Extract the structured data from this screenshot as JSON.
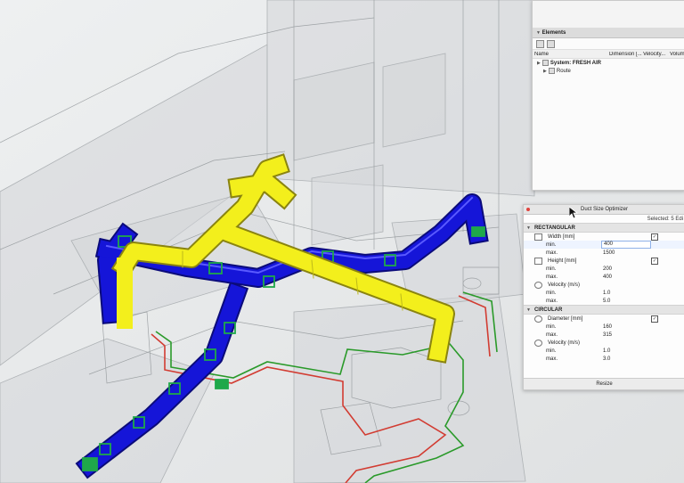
{
  "elements_panel": {
    "header": "Elements",
    "columns": {
      "name": "Name",
      "dimension": "Dimension [...",
      "velocity": "Velocity...",
      "volume": "Volum"
    },
    "tree": [
      {
        "label": "System: FRESH AIR"
      },
      {
        "label": "Route"
      }
    ]
  },
  "optimizer": {
    "title": "Duct Size Optimizer",
    "selected": "Selected: 5 Edi",
    "rectangular": {
      "title": "RECTANGULAR",
      "width": {
        "label": "Width [mm]",
        "min_label": "min.",
        "min": "400",
        "max_label": "max.",
        "max": "1500"
      },
      "height": {
        "label": "Height [mm]",
        "min_label": "min.",
        "min": "200",
        "max_label": "max.",
        "max": "400"
      },
      "velocity": {
        "label": "Velocity (m/s)",
        "min_label": "min.",
        "min": "1.0",
        "max_label": "max.",
        "max": "5.0"
      }
    },
    "circular": {
      "title": "CIRCULAR",
      "diameter": {
        "label": "Diameter [mm]",
        "min_label": "min.",
        "min": "160",
        "max_label": "max.",
        "max": "315"
      },
      "velocity": {
        "label": "Velocity (m/s)",
        "min_label": "min.",
        "min": "1.0",
        "max_label": "max.",
        "max": "3.0"
      }
    },
    "checkmark": "✓",
    "resize_label": "Resize"
  },
  "colors": {
    "supply_duct": "#1515d8",
    "fresh_air_duct": "#f3ef1c",
    "pipe_red": "#d23c32",
    "pipe_green": "#2a9a2a",
    "damper_green": "#1fa84a"
  }
}
